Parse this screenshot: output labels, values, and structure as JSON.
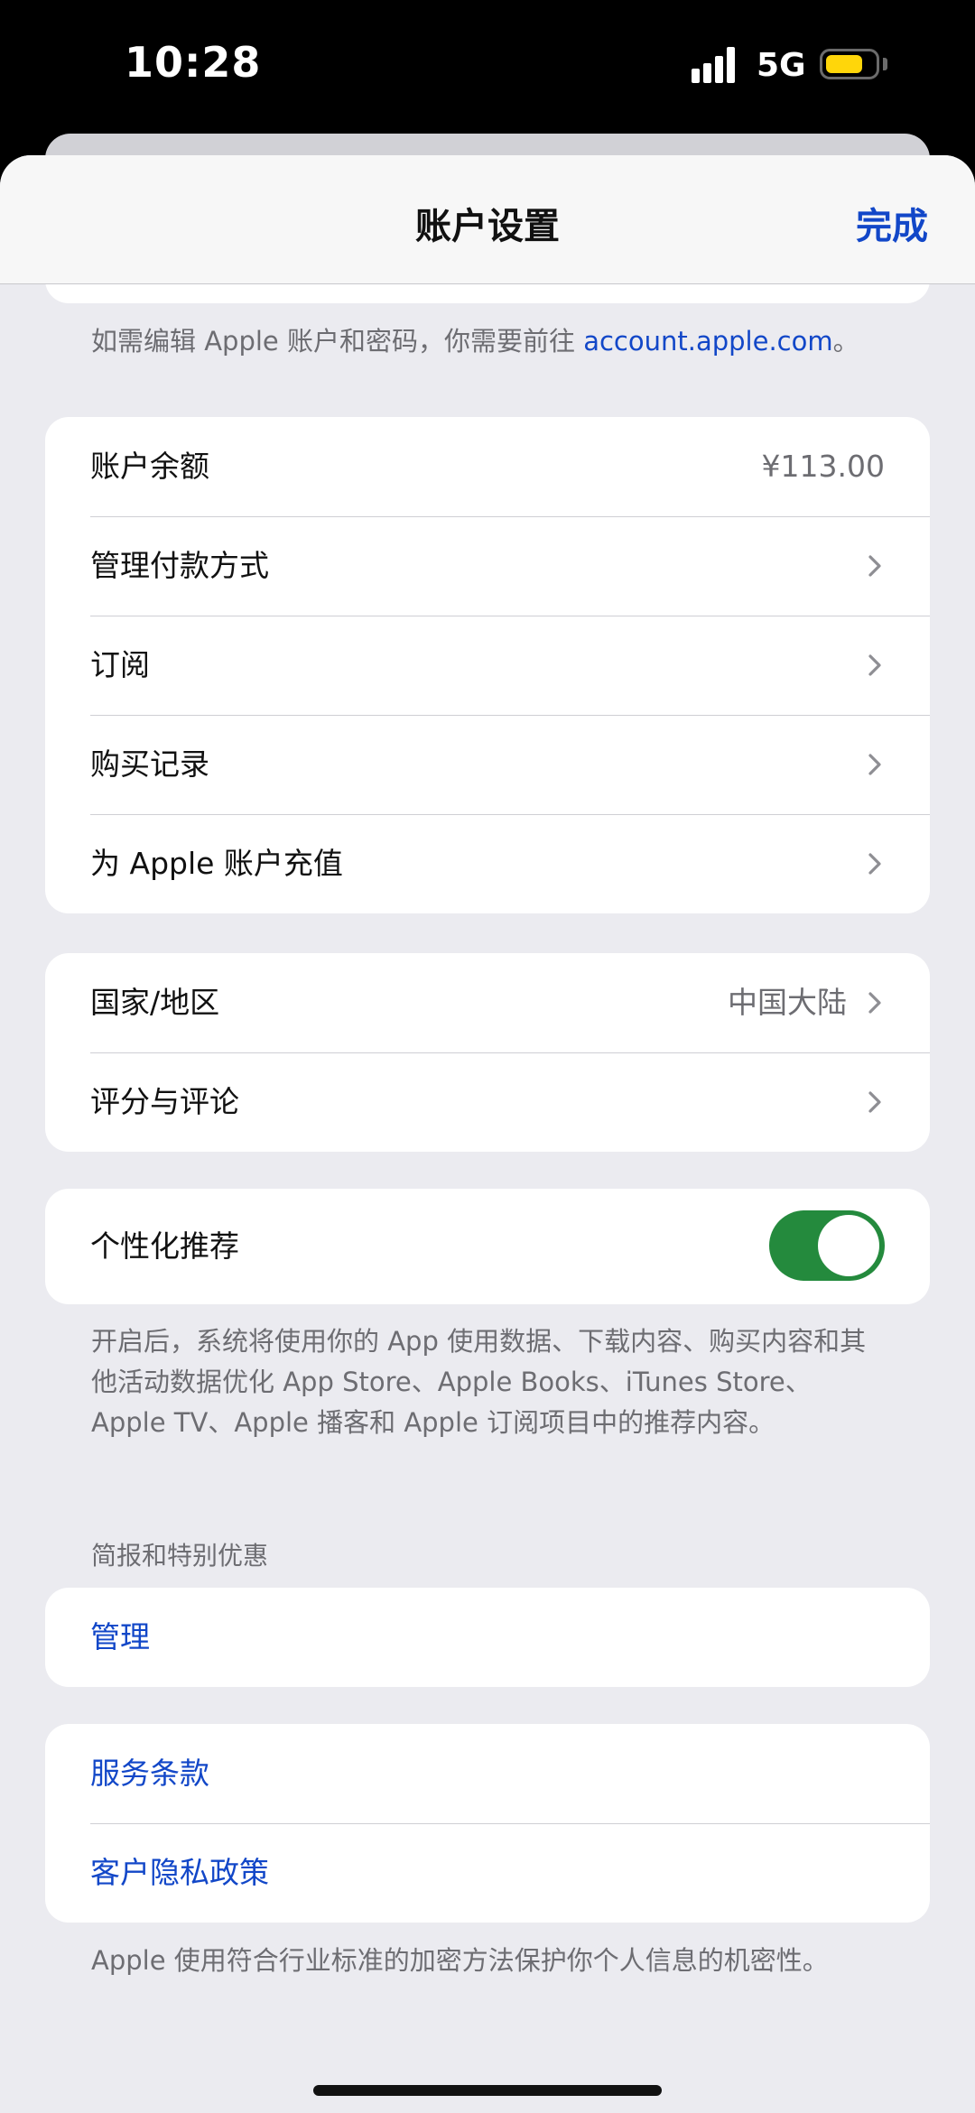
{
  "status_bar": {
    "time": "10:28",
    "network": "5G",
    "battery_color": "#ffd60a"
  },
  "nav": {
    "title": "账户设置",
    "done_label": "完成"
  },
  "apple_account_note": {
    "text": "如需编辑 Apple 账户和密码，你需要前往 ",
    "link": "account.apple.com",
    "suffix": "。"
  },
  "account_group": {
    "balance_label": "账户余额",
    "balance_value": "¥113.00",
    "manage_payment_label": "管理付款方式",
    "subscriptions_label": "订阅",
    "purchase_history_label": "购买记录",
    "add_funds_label": "为 Apple 账户充值"
  },
  "region_group": {
    "country_label": "国家/地区",
    "country_value": "中国大陆",
    "ratings_label": "评分与评论"
  },
  "personalization": {
    "label": "个性化推荐",
    "enabled": true,
    "footnote": "开启后，系统将使用你的 App 使用数据、下载内容、购买内容和其他活动数据优化 App Store、Apple Books、iTunes Store、Apple TV、Apple 播客和 Apple 订阅项目中的推荐内容。"
  },
  "newsletters": {
    "header": "简报和特别优惠",
    "manage_label": "管理"
  },
  "legal": {
    "terms_label": "服务条款",
    "privacy_label": "客户隐私政策",
    "footnote": "Apple 使用符合行业标准的加密方法保护你个人信息的机密性。"
  },
  "colors": {
    "accent": "#1247c8",
    "toggle_on": "#248a3d",
    "background": "#ebebf0"
  }
}
